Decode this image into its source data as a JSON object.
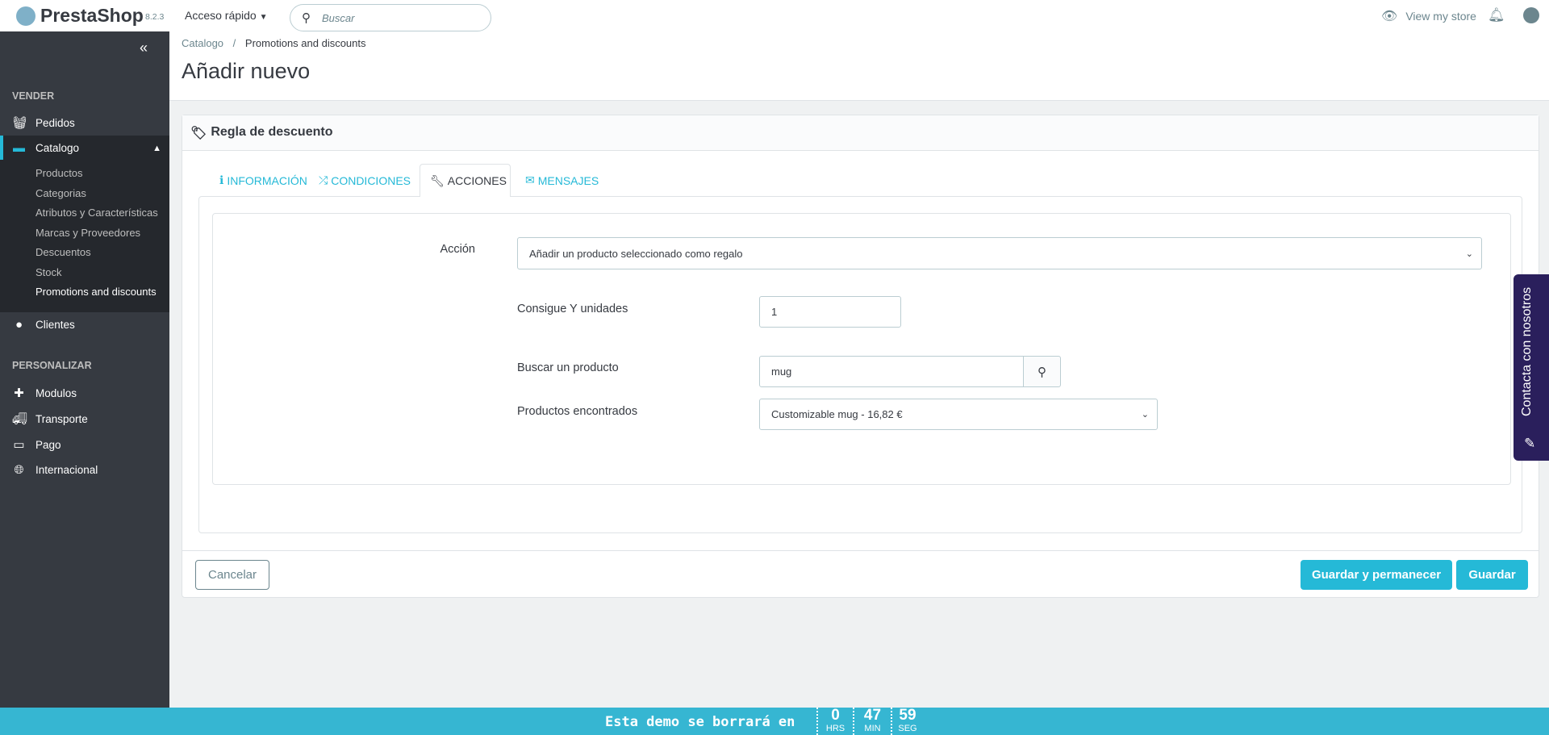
{
  "header": {
    "logo": "PrestaShop",
    "version": "8.2.3",
    "quick_access": "Acceso rápido",
    "search_placeholder": "Buscar",
    "view_store": "View my store"
  },
  "sidebar": {
    "sections": [
      {
        "label": "VENDER"
      },
      {
        "label": "PERSONALIZAR"
      }
    ],
    "items": {
      "pedidos": "Pedidos",
      "catalogo": "Catalogo",
      "clientes": "Clientes",
      "modulos": "Modulos",
      "transporte": "Transporte",
      "pago": "Pago",
      "internacional": "Internacional"
    },
    "catalog_sub": [
      "Productos",
      "Categorias",
      "Atributos y Características",
      "Marcas y Proveedores",
      "Descuentos",
      "Stock",
      "Promotions and discounts"
    ]
  },
  "breadcrumb": {
    "parent": "Catalogo",
    "current": "Promotions and discounts"
  },
  "page_title": "Añadir nuevo",
  "panel": {
    "title": "Regla de descuento",
    "tabs": [
      "INFORMACIÓN",
      "CONDICIONES",
      "ACCIONES",
      "MENSAJES"
    ],
    "form": {
      "action_label": "Acción",
      "action_value": "Añadir un producto seleccionado como regalo",
      "units_label": "Consigue Y unidades",
      "units_value": "1",
      "search_label": "Buscar un producto",
      "search_value": "mug",
      "found_label": "Productos encontrados",
      "found_value": "Customizable mug - 16,82 €"
    },
    "buttons": {
      "cancel": "Cancelar",
      "save_stay": "Guardar y permanecer",
      "save": "Guardar"
    }
  },
  "contact_tab": "Contacta con nosotros",
  "demo_bar": {
    "text": "Esta demo se borrará en",
    "hours": "0",
    "hours_label": "HRS",
    "minutes": "47",
    "minutes_label": "MIN",
    "seconds": "59",
    "seconds_label": "SEG"
  },
  "colors": {
    "accent": "#25b9d7",
    "sidebar": "#363a41",
    "contact": "#2a1f5c",
    "brand": "#df0067"
  }
}
